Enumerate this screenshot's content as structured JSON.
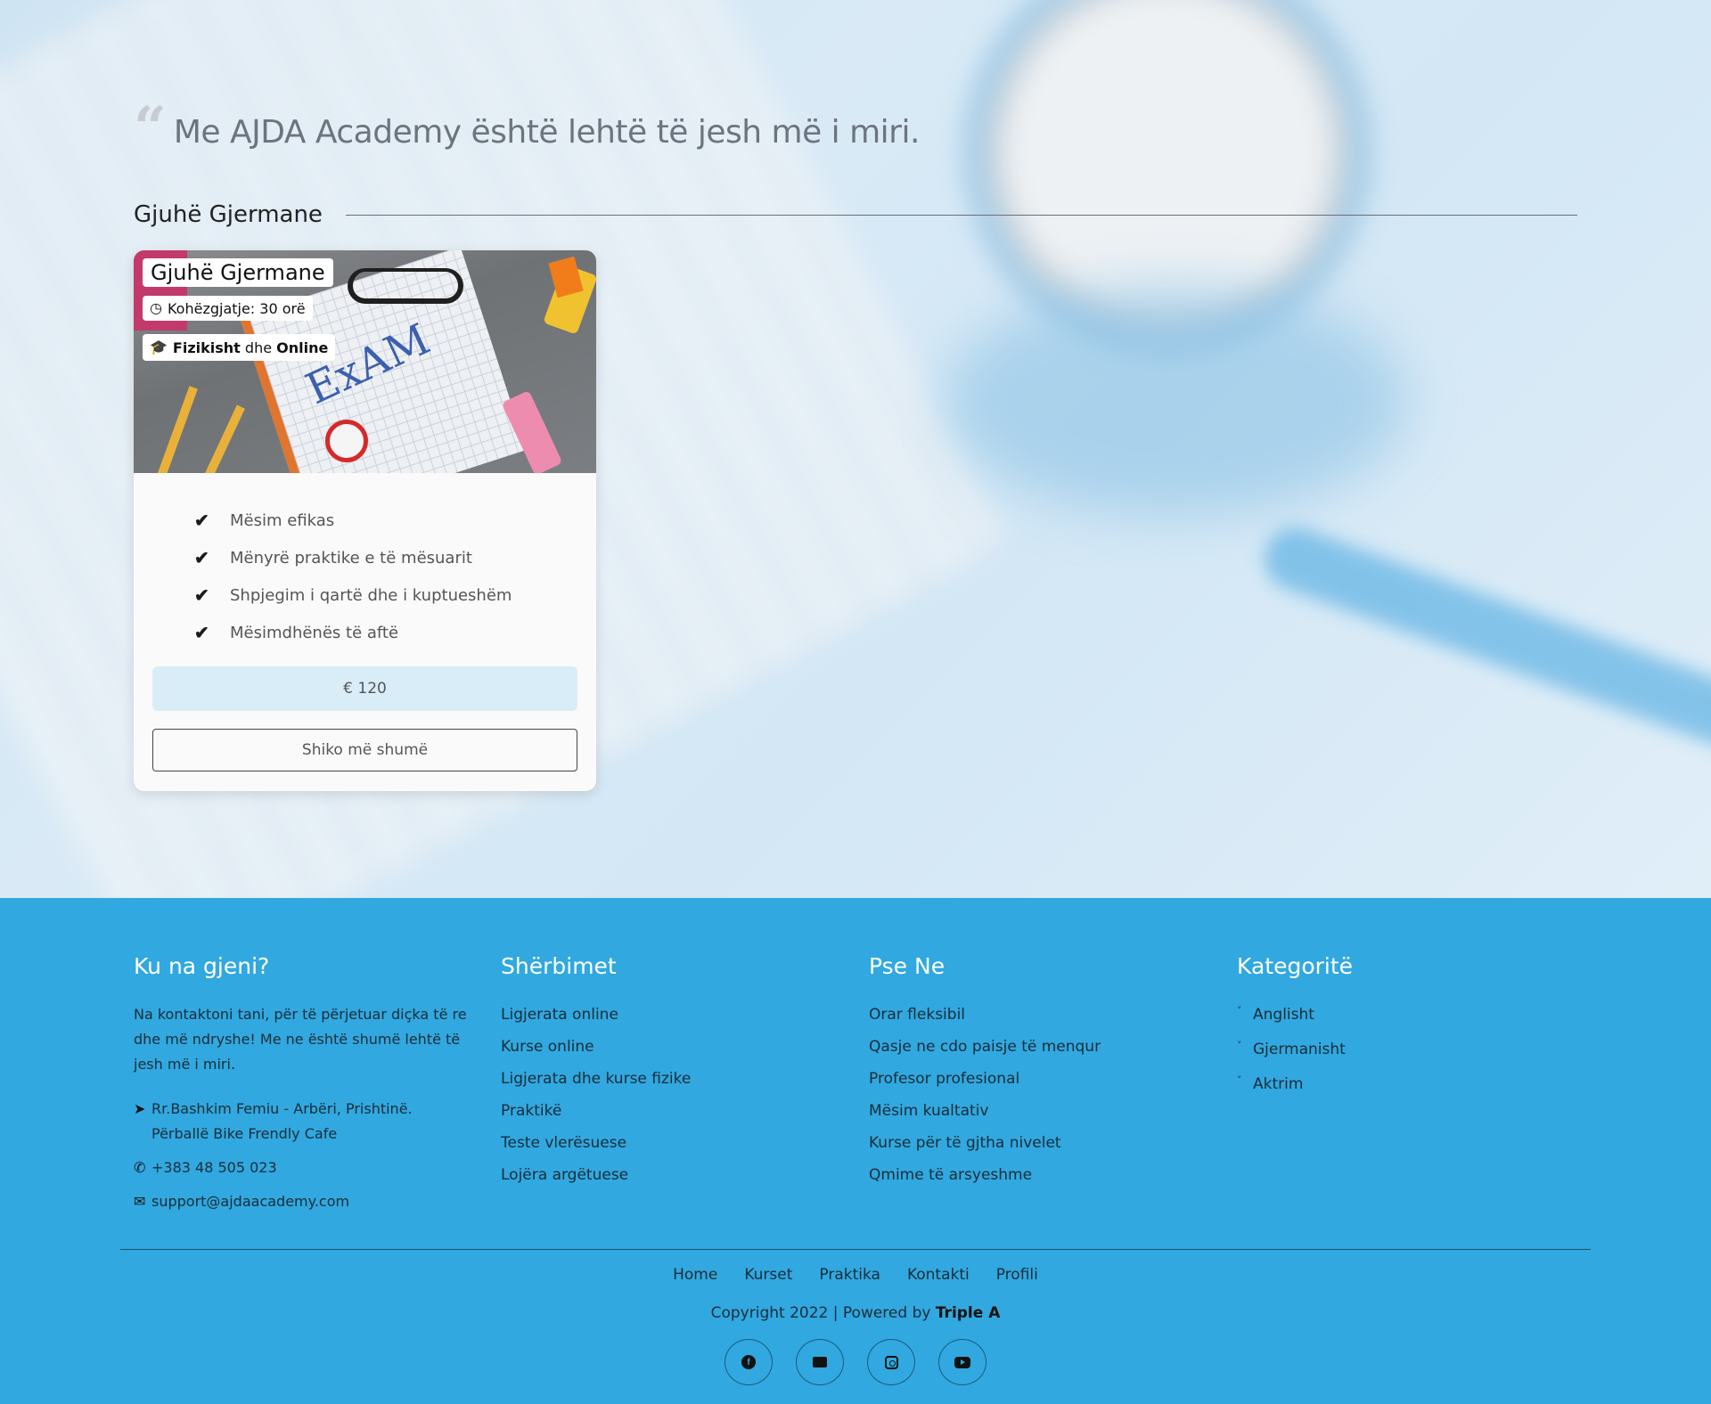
{
  "hero": {
    "quote_icon": "quote-left-icon",
    "quote": "Me AJDA Academy është lehtë të jesh më i miri.",
    "section_title": "Gjuhë Gjermane"
  },
  "card": {
    "title": "Gjuhë Gjermane",
    "duration_icon": "clock-icon",
    "duration": "Kohëzgjatje: 30 orë",
    "mode_icon": "graduation-cap-icon",
    "mode_strong1": "Fizikisht",
    "mode_middle": " dhe ",
    "mode_strong2": "Online",
    "features": [
      "Mësim efikas",
      "Mënyrë praktike e të mësuarit",
      "Shpjegim i qartë dhe i kuptueshëm",
      "Mësimdhënës të aftë"
    ],
    "price": "€ 120",
    "more_label": "Shiko më shumë"
  },
  "footer": {
    "col1": {
      "title": "Ku na gjeni?",
      "text": "Na kontaktoni tani, për të përjetuar diçka të re dhe më ndryshe! Me ne është shumë lehtë të jesh më i miri.",
      "address": "Rr.Bashkim Femiu - Arbëri, Prishtinë. Përballë Bike Frendly Cafe",
      "phone": "+383 48 505 023",
      "email": "support@ajdaacademy.com"
    },
    "col2": {
      "title": "Shërbimet",
      "items": [
        "Ligjerata online",
        "Kurse online",
        "Ligjerata dhe kurse fizike",
        "Praktikë",
        "Teste vlerësuese",
        "Lojëra argëtuese"
      ]
    },
    "col3": {
      "title": "Pse Ne",
      "items": [
        "Orar fleksibil",
        "Qasje ne cdo paisje të menqur",
        "Profesor profesional",
        "Mësim kualtativ",
        "Kurse për të gjtha nivelet",
        "Qmime të arsyeshme"
      ]
    },
    "col4": {
      "title": "Kategoritë",
      "items": [
        "Anglisht",
        "Gjermanisht",
        "Aktrim"
      ]
    },
    "nav": [
      "Home",
      "Kurset",
      "Praktika",
      "Kontakti",
      "Profili"
    ],
    "copyright_prefix": "Copyright 2022 | Powered by ",
    "copyright_brand": "Triple A",
    "socials": [
      "facebook-icon",
      "envelope-icon",
      "instagram-icon",
      "youtube-icon"
    ],
    "colors": {
      "footer_bg": "#31a8df",
      "price_bg": "#d8edf8"
    }
  }
}
